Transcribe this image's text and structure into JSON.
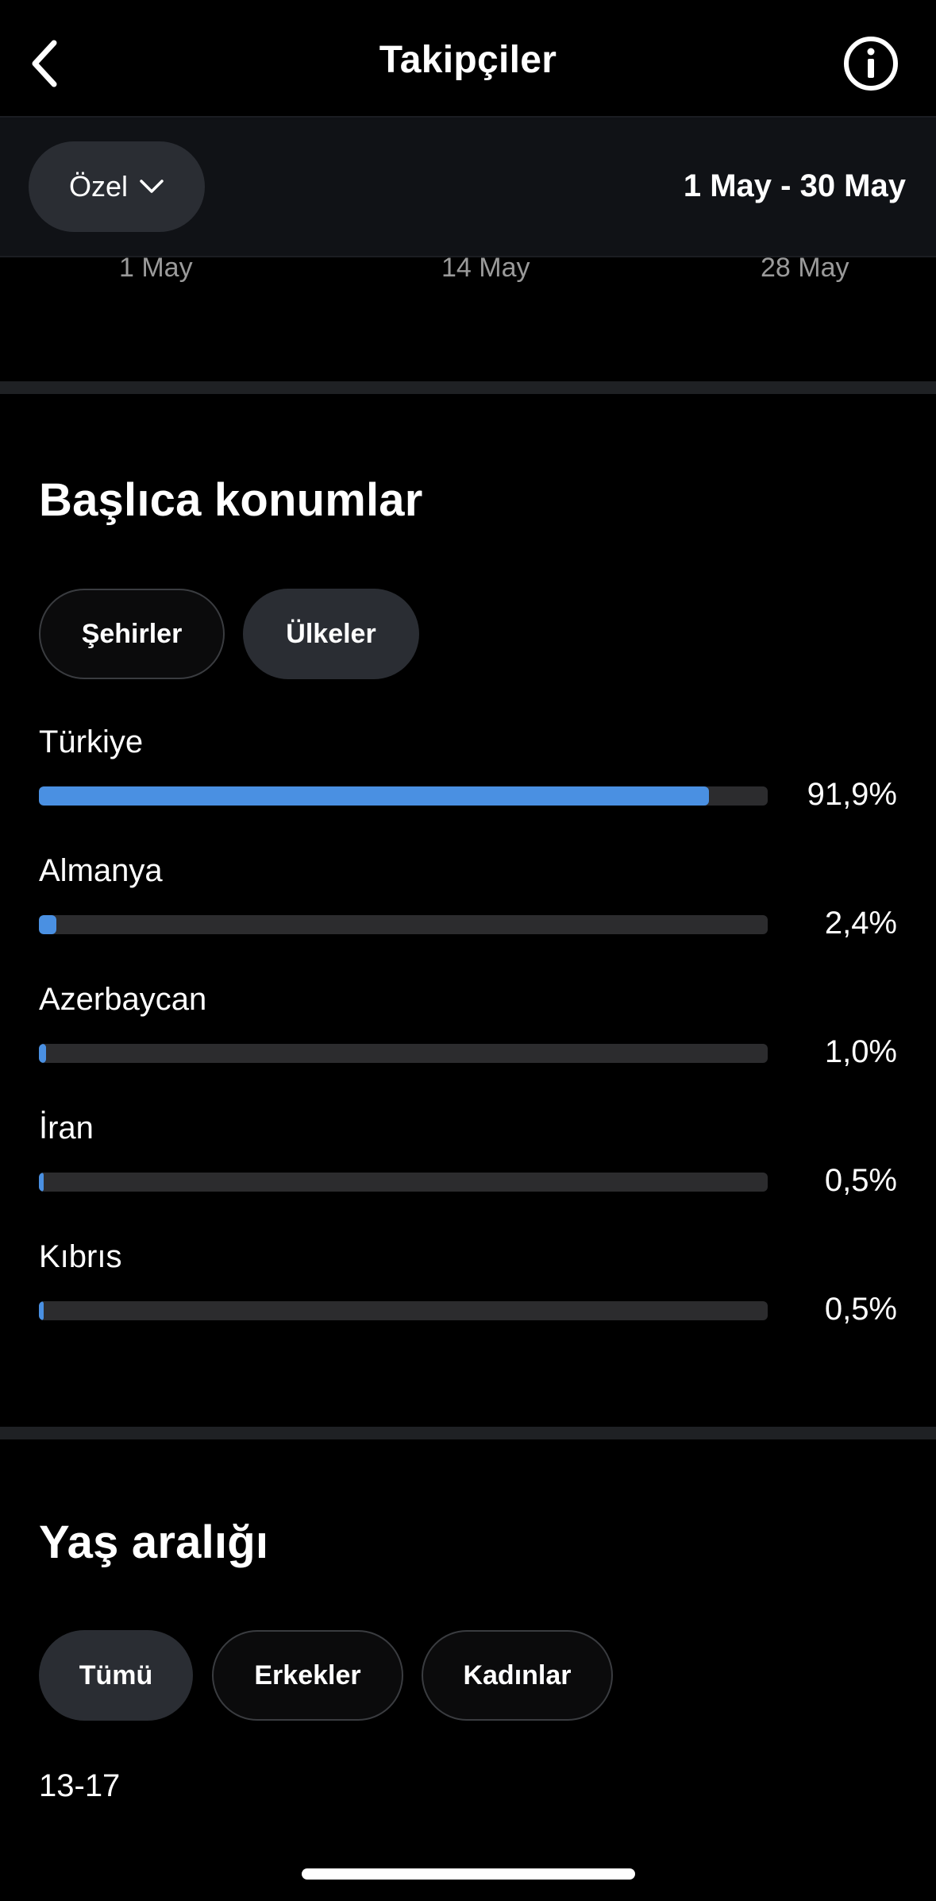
{
  "header": {
    "title": "Takipçiler"
  },
  "filter": {
    "range_button": "Özel",
    "date_range": "1 May - 30 May"
  },
  "chart_axis": {
    "ticks": [
      "1 May",
      "14 May",
      "28 May"
    ]
  },
  "locations": {
    "title": "Başlıca konumlar",
    "tabs": [
      {
        "label": "Şehirler",
        "selected": false
      },
      {
        "label": "Ülkeler",
        "selected": true
      }
    ],
    "items": [
      {
        "name": "Türkiye",
        "percent_label": "91,9%",
        "value": 91.9
      },
      {
        "name": "Almanya",
        "percent_label": "2,4%",
        "value": 2.4
      },
      {
        "name": "Azerbaycan",
        "percent_label": "1,0%",
        "value": 1.0
      },
      {
        "name": "İran",
        "percent_label": "0,5%",
        "value": 0.5
      },
      {
        "name": "Kıbrıs",
        "percent_label": "0,5%",
        "value": 0.5
      }
    ]
  },
  "age": {
    "title": "Yaş aralığı",
    "tabs": [
      {
        "label": "Tümü",
        "selected": true
      },
      {
        "label": "Erkekler",
        "selected": false
      },
      {
        "label": "Kadınlar",
        "selected": false
      }
    ],
    "first_range": "13-17"
  },
  "colors": {
    "accent": "#4a90e2",
    "track": "#2c2c2e",
    "background": "#000000"
  }
}
